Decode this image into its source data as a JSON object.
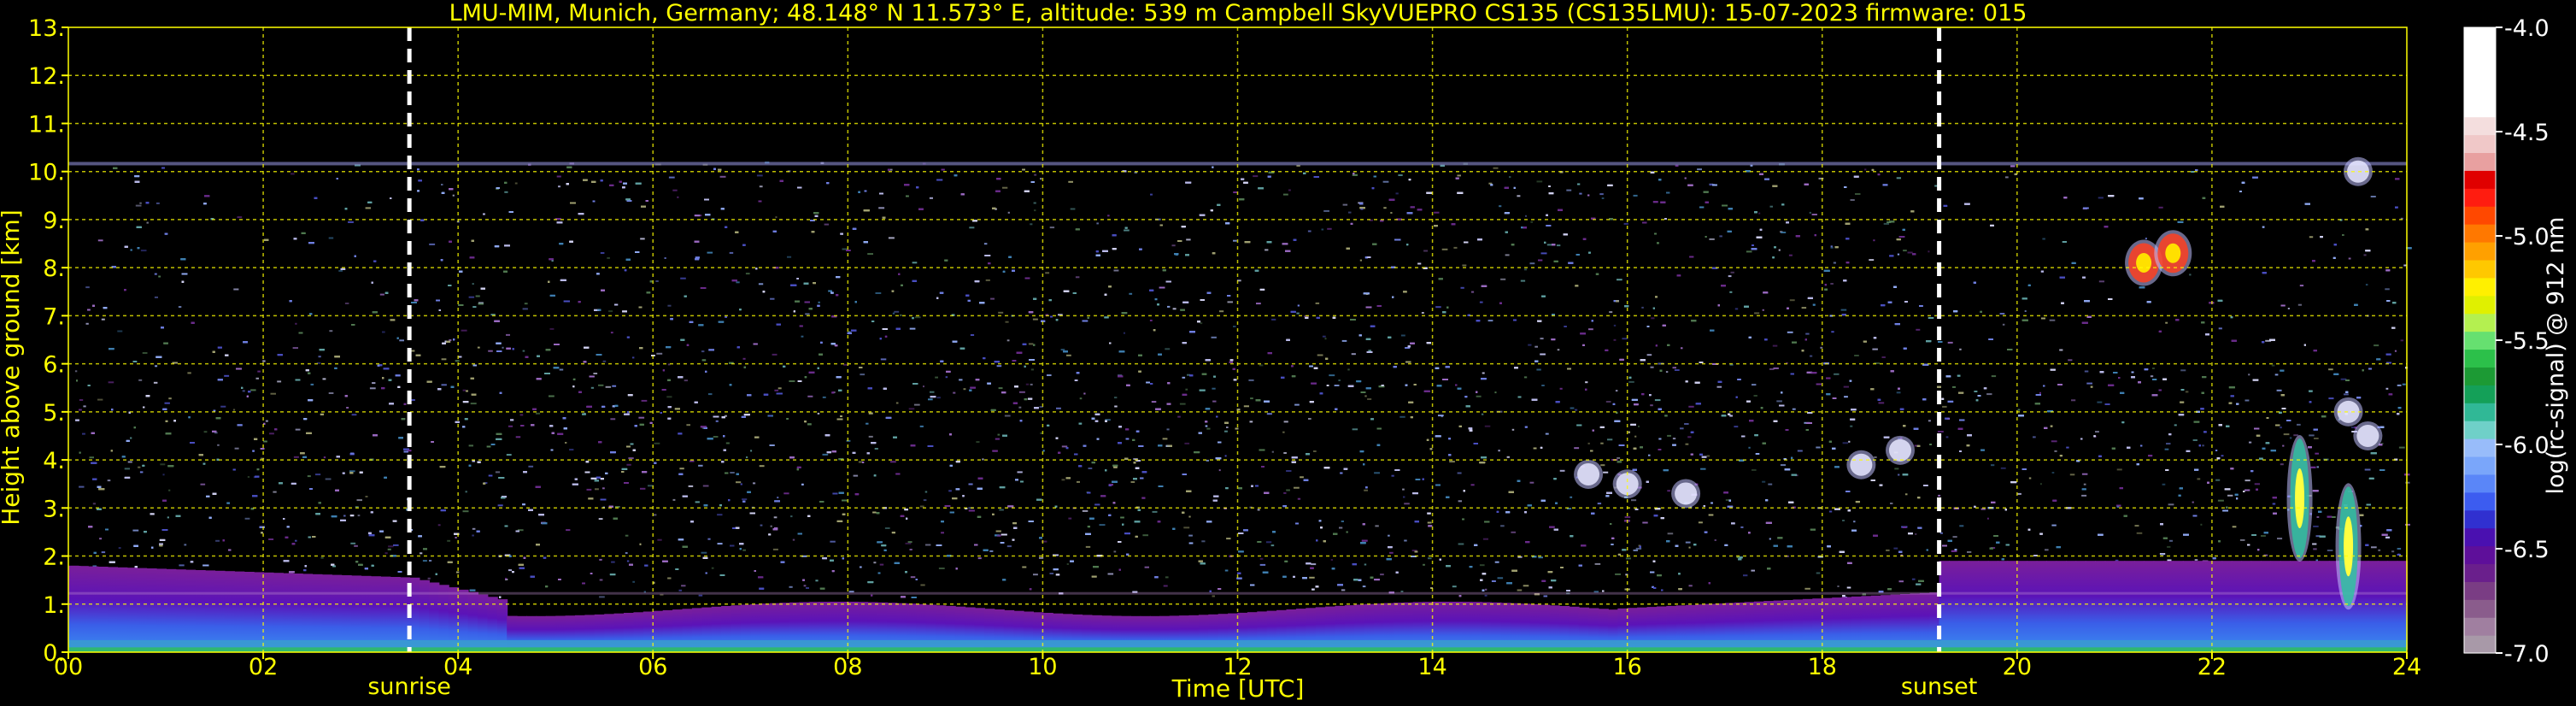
{
  "chart_data": {
    "type": "heatmap",
    "title": "LMU-MIM, Munich, Germany; 48.148° N 11.573° E, altitude: 539 m    Campbell SkyVUEPRO CS135 (CS135LMU): 15-07-2023    firmware: 015",
    "xlabel": "Time [UTC]",
    "ylabel": "Height above ground [km]",
    "xlim": [
      0,
      24
    ],
    "ylim": [
      0,
      13
    ],
    "x_ticks": [
      "00",
      "02",
      "04",
      "06",
      "08",
      "10",
      "12",
      "14",
      "16",
      "18",
      "20",
      "22",
      "24"
    ],
    "y_ticks": [
      "0.",
      "1.",
      "2.",
      "3.",
      "4.",
      "5.",
      "6.",
      "7.",
      "8.",
      "9.",
      "10.",
      "11.",
      "12.",
      "13."
    ],
    "grid": true,
    "max_range_km": 10.2,
    "events": [
      {
        "label": "sunrise",
        "time_utc": 3.5
      },
      {
        "label": "sunset",
        "time_utc": 19.2
      }
    ],
    "colorbar": {
      "label": "log(rc-signal) @ 912 nm",
      "range": [
        -7.0,
        -4.0
      ],
      "ticks": [
        "-4.0",
        "-4.5",
        "-5.0",
        "-5.5",
        "-6.0",
        "-6.5",
        "-7.0"
      ],
      "colors": [
        "#a899a8",
        "#a07fa0",
        "#8a5c8c",
        "#7a3d84",
        "#6a1f8c",
        "#5e0f9a",
        "#4a10b0",
        "#3030d0",
        "#3c5cf0",
        "#5a86f8",
        "#7aa6fa",
        "#98bcfa",
        "#6fd0c8",
        "#30b896",
        "#14a058",
        "#1c9a34",
        "#2cc04a",
        "#66e070",
        "#b4f050",
        "#e0f000",
        "#fff000",
        "#ffc800",
        "#ffa000",
        "#ff7800",
        "#ff4800",
        "#ff1c10",
        "#e00000",
        "#e8a0a0",
        "#f0c8c8",
        "#f4dede",
        "#ffffff",
        "#ffffff",
        "#ffffff",
        "#ffffff",
        "#ffffff"
      ]
    },
    "cloud_events": [
      {
        "time_utc": 15.6,
        "height_km": 3.7
      },
      {
        "time_utc": 16.0,
        "height_km": 3.5
      },
      {
        "time_utc": 16.6,
        "height_km": 3.3
      },
      {
        "time_utc": 18.4,
        "height_km": 3.9
      },
      {
        "time_utc": 18.8,
        "height_km": 4.2
      },
      {
        "time_utc": 21.3,
        "height_km": 8.1
      },
      {
        "time_utc": 21.6,
        "height_km": 8.3
      },
      {
        "time_utc": 22.9,
        "height_km": 3.2
      },
      {
        "time_utc": 23.4,
        "height_km": 2.2
      },
      {
        "time_utc": 23.4,
        "height_km": 5.0
      },
      {
        "time_utc": 23.6,
        "height_km": 4.5
      },
      {
        "time_utc": 23.5,
        "height_km": 10.0
      }
    ]
  }
}
